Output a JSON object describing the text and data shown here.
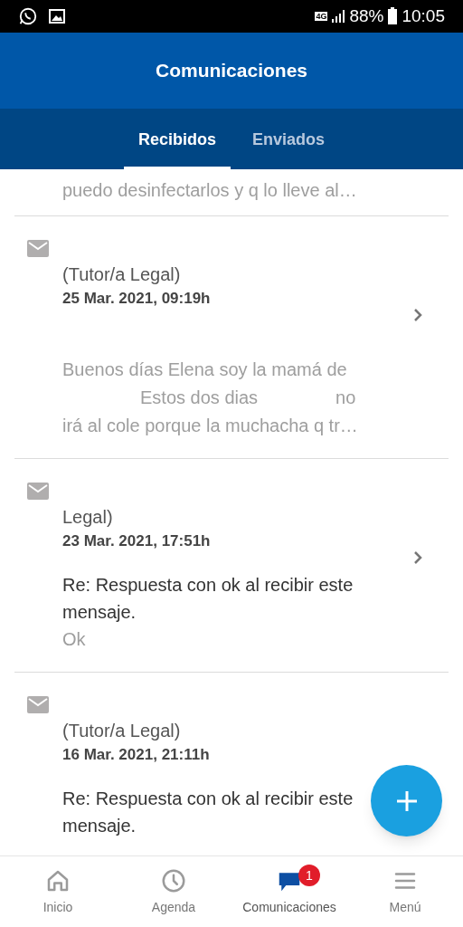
{
  "status_bar": {
    "network": "4G",
    "battery": "88%",
    "time": "10:05"
  },
  "header": {
    "title": "Comunicaciones"
  },
  "tabs": [
    {
      "label": "Recibidos",
      "selected": true
    },
    {
      "label": "Enviados",
      "selected": false
    }
  ],
  "messages": [
    {
      "preview_lines": [
        [
          "puedo desinfectarlos y q lo lleve al…"
        ]
      ],
      "chevron": false
    },
    {
      "sender": "(Tutor/a Legal)",
      "date": "25 Mar. 2021, 09:19h",
      "preview_lines": [
        [
          "Buenos días Elena soy la mamá de"
        ],
        [
          "Estos dos dias",
          "no"
        ],
        [
          "irá al cole porque la muchacha q tr…"
        ]
      ],
      "chevron": true
    },
    {
      "sender": "Legal)",
      "date": "23 Mar. 2021, 17:51h",
      "subject": "Re: Respuesta con ok al recibir este mensaje.",
      "preview_lines": [
        [
          "Ok"
        ]
      ],
      "chevron": true
    },
    {
      "sender": "(Tutor/a Legal)",
      "date": "16 Mar. 2021, 21:11h",
      "subject": "Re: Respuesta con ok al recibir este mensaje.",
      "chevron": false
    }
  ],
  "bottom_nav": [
    {
      "kind": "home",
      "label": "Inicio",
      "selected": false
    },
    {
      "kind": "clock",
      "label": "Agenda",
      "selected": false
    },
    {
      "kind": "chat",
      "label": "Comunicaciones",
      "selected": true,
      "badge": "1"
    },
    {
      "kind": "menu",
      "label": "Menú",
      "selected": false
    }
  ]
}
